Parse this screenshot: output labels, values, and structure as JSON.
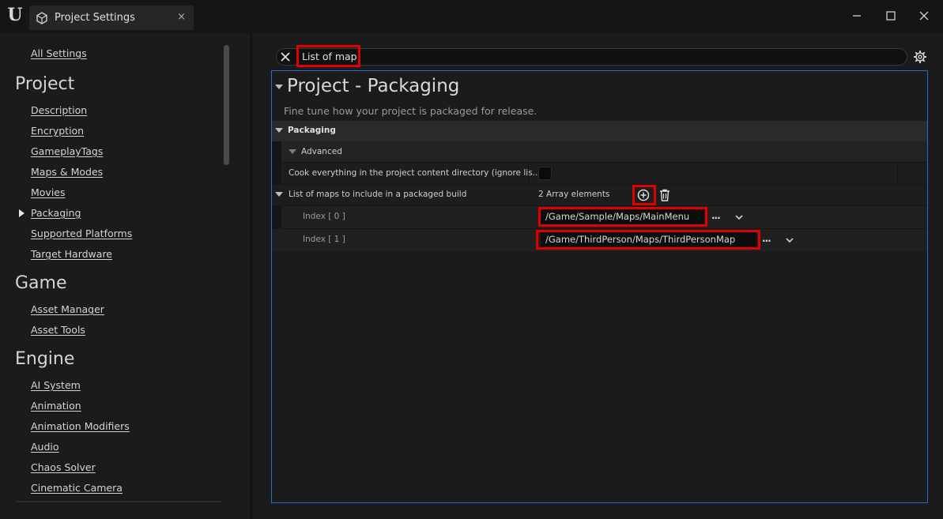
{
  "window": {
    "tab_title": "Project Settings",
    "tab_close": "×"
  },
  "sidebar": {
    "all_settings": "All Settings",
    "sections": [
      {
        "title": "Project",
        "items": [
          "Description",
          "Encryption",
          "GameplayTags",
          "Maps & Modes",
          "Movies",
          "Packaging",
          "Supported Platforms",
          "Target Hardware"
        ]
      },
      {
        "title": "Game",
        "items": [
          "Asset Manager",
          "Asset Tools"
        ]
      },
      {
        "title": "Engine",
        "items": [
          "AI System",
          "Animation",
          "Animation Modifiers",
          "Audio",
          "Chaos Solver",
          "Cinematic Camera"
        ]
      }
    ],
    "selected_item": "Packaging"
  },
  "search": {
    "value": "List of map"
  },
  "panel": {
    "title": "Project - Packaging",
    "description": "Fine tune how your project is packaged for release.",
    "category": "Packaging",
    "subcategory": "Advanced",
    "cook_label": "Cook everything in the project content directory (ignore lis...",
    "cook_checked": false,
    "list_label": "List of maps to include in a packaged build",
    "array_count": "2 Array elements",
    "elements": [
      {
        "index_label": "Index [ 0 ]",
        "value": "/Game/Sample/Maps/MainMenu"
      },
      {
        "index_label": "Index [ 1 ]",
        "value": "/Game/ThirdPerson/Maps/ThirdPersonMap"
      }
    ],
    "more_label": "..."
  },
  "colors": {
    "highlight": "#e10000",
    "panel_border": "#1f6fd1",
    "background": "#1b1b1b"
  }
}
